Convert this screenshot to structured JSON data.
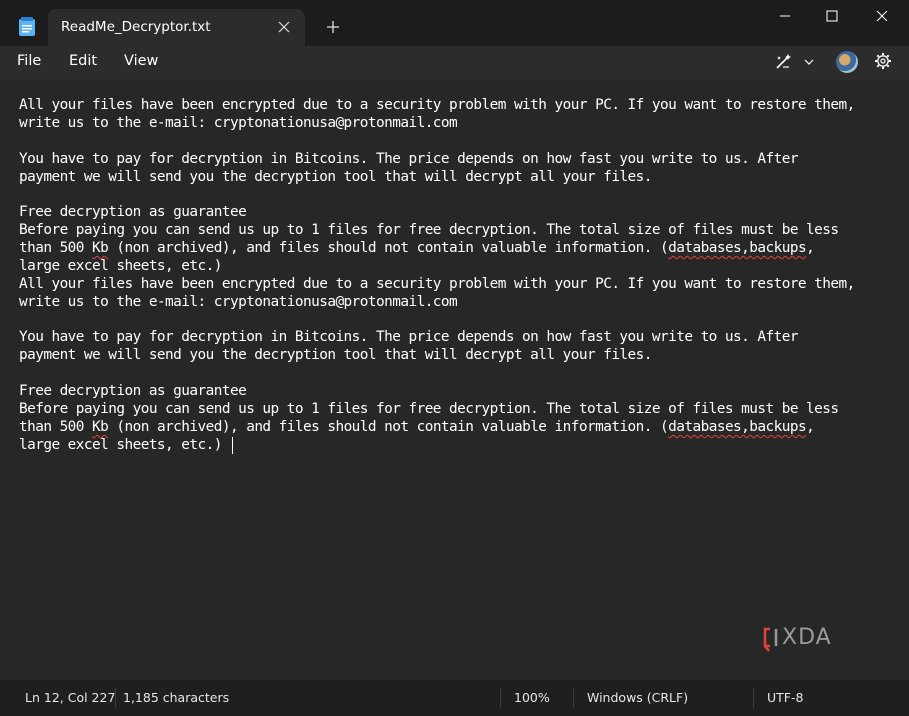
{
  "window": {
    "tab_title": "ReadMe_Decryptor.txt"
  },
  "menu": {
    "file": "File",
    "edit": "Edit",
    "view": "View"
  },
  "editor": {
    "lines": [
      "All your files have been encrypted due to a security problem with your PC. If you want to restore them,",
      "write us to the e-mail: cryptonationusa@protonmail.com",
      "",
      "You have to pay for decryption in Bitcoins. The price depends on how fast you write to us. After",
      "payment we will send you the decryption tool that will decrypt all your files.",
      "",
      "Free decryption as guarantee",
      "Before paying you can send us up to 1 files for free decryption. The total size of files must be less",
      "than 500 Kb (non archived), and files should not contain valuable information. (databases,backups,",
      "large excel sheets, etc.)",
      "All your files have been encrypted due to a security problem with your PC. If you want to restore them,",
      "write us to the e-mail: cryptonationusa@protonmail.com",
      "",
      "You have to pay for decryption in Bitcoins. The price depends on how fast you write to us. After",
      "payment we will send you the decryption tool that will decrypt all your files.",
      "",
      "Free decryption as guarantee",
      "Before paying you can send us up to 1 files for free decryption. The total size of files must be less",
      "than 500 Kb (non archived), and files should not contain valuable information. (databases,backups,",
      "large excel sheets, etc.)"
    ]
  },
  "watermark": "XDA",
  "status": {
    "position": "Ln 12, Col 227",
    "characters": "1,185 characters",
    "zoom": "100%",
    "line_ending": "Windows (CRLF)",
    "encoding": "UTF-8"
  },
  "colors": {
    "background": "#272727",
    "titlebar": "#1c1c1c",
    "spellcheck": "#e0443b",
    "watermark_accent": "#e0443b"
  },
  "icons": {
    "app": "notepad-icon",
    "tab_close": "close-icon",
    "new_tab": "plus-icon",
    "minimize": "minimize-icon",
    "maximize": "maximize-icon",
    "close": "close-icon",
    "copilot": "copilot-icon",
    "dropdown": "chevron-down-icon",
    "settings": "gear-icon"
  }
}
